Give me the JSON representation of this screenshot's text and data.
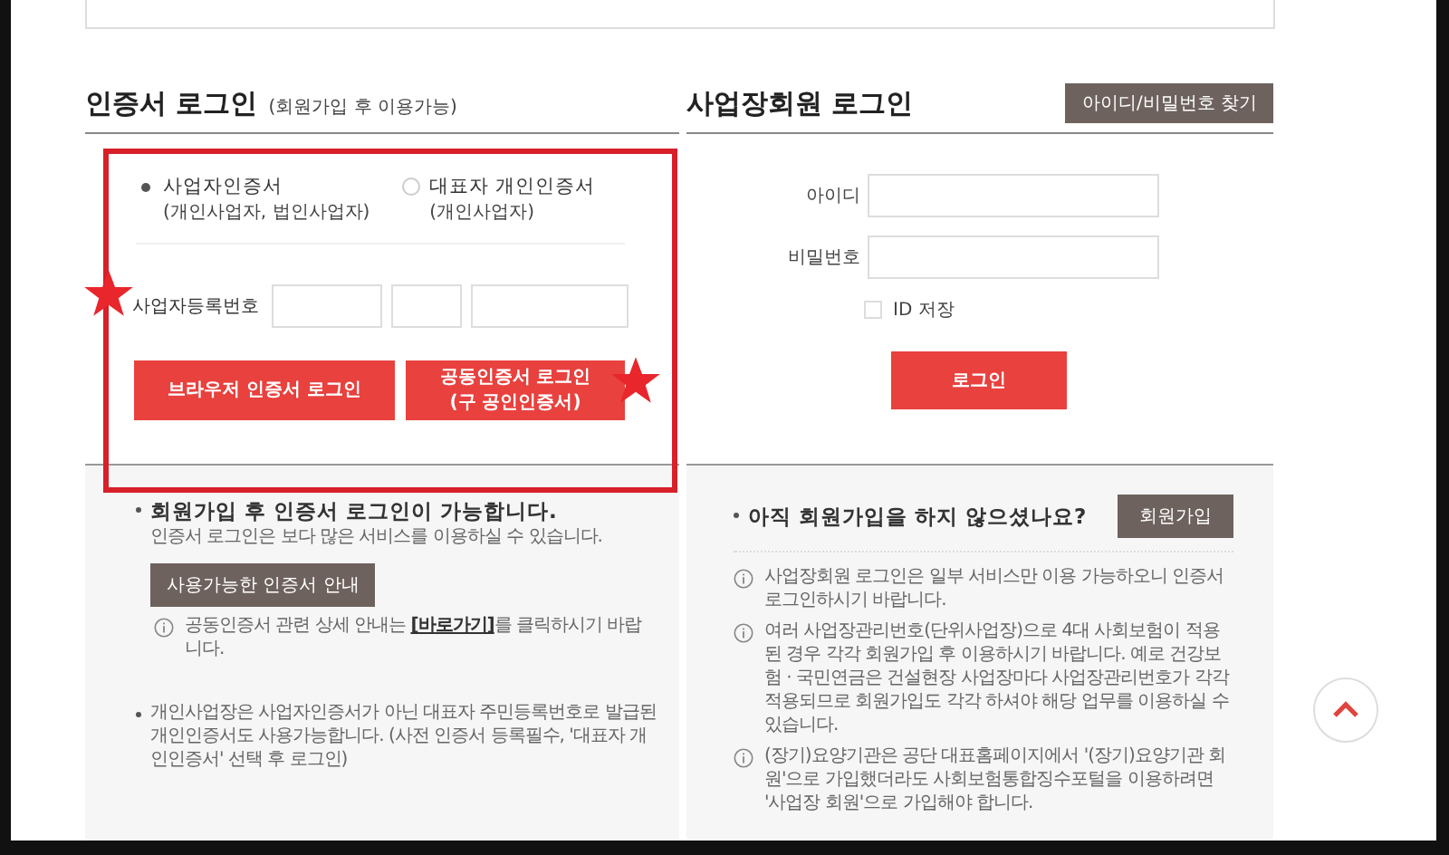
{
  "cert_login": {
    "title": "인증서 로그인",
    "subtitle": "(회원가입 후 이용가능)",
    "options": [
      {
        "label": "사업자인증서",
        "note": "(개인사업자, 법인사업자)",
        "selected": true
      },
      {
        "label": "대표자 개인인증서",
        "note": "(개인사업자)",
        "selected": false
      }
    ],
    "reg_number": {
      "label": "사업자등록번호"
    },
    "buttons": [
      {
        "label": "브라우저 인증서 로그인"
      },
      {
        "label": "공동인증서 로그인",
        "sublabel": "(구 공인인증서)"
      }
    ]
  },
  "member_login": {
    "title": "사업장회원 로그인",
    "find_button": "아이디/비밀번호 찾기",
    "fields": [
      {
        "label": "아이디"
      },
      {
        "label": "비밀번호"
      }
    ],
    "save_id": {
      "label": "ID 저장",
      "checked": false
    },
    "login_button": "로그인"
  },
  "cert_info": {
    "heading": "회원가입 후 인증서 로그인이 가능합니다.",
    "text": "인증서 로그인은 보다 많은 서비스를 이용하실 수 있습니다.",
    "guide_button": "사용가능한 인증서 안내",
    "info_before": "공동인증서 관련 상세 안내는 ",
    "info_link": "[바로가기]",
    "info_after": "를 클릭하시기 바랍니다.",
    "note": "개인사업장은 사업자인증서가 아닌 대표자 주민등록번호로 발급된 개인인증서도 사용가능합니다. (사전 인증서 등록필수, '대표자 개인인증서' 선택 후 로그인)"
  },
  "member_info": {
    "question": "아직 회원가입을 하지 않으셨나요?",
    "signup_button": "회원가입",
    "notes": [
      "사업장회원 로그인은 일부 서비스만 이용 가능하오니 인증서 로그인하시기 바랍니다.",
      "여러 사업장관리번호(단위사업장)으로 4대 사회보험이 적용된 경우 각각 회원가입 후 이용하시기 바랍니다. 예로 건강보험 · 국민연금은 건설현장 사업장마다 사업장관리번호가 각각 적용되므로 회원가입도 각각 하셔야 해당 업무를 이용하실 수 있습니다.",
      "(장기)요양기관은 공단 대표홈페이지에서 '(장기)요양기관 회원'으로 가입했더라도 사회보험통합징수포털을 이용하려면 '사업장 회원'으로 가입해야 합니다."
    ]
  }
}
